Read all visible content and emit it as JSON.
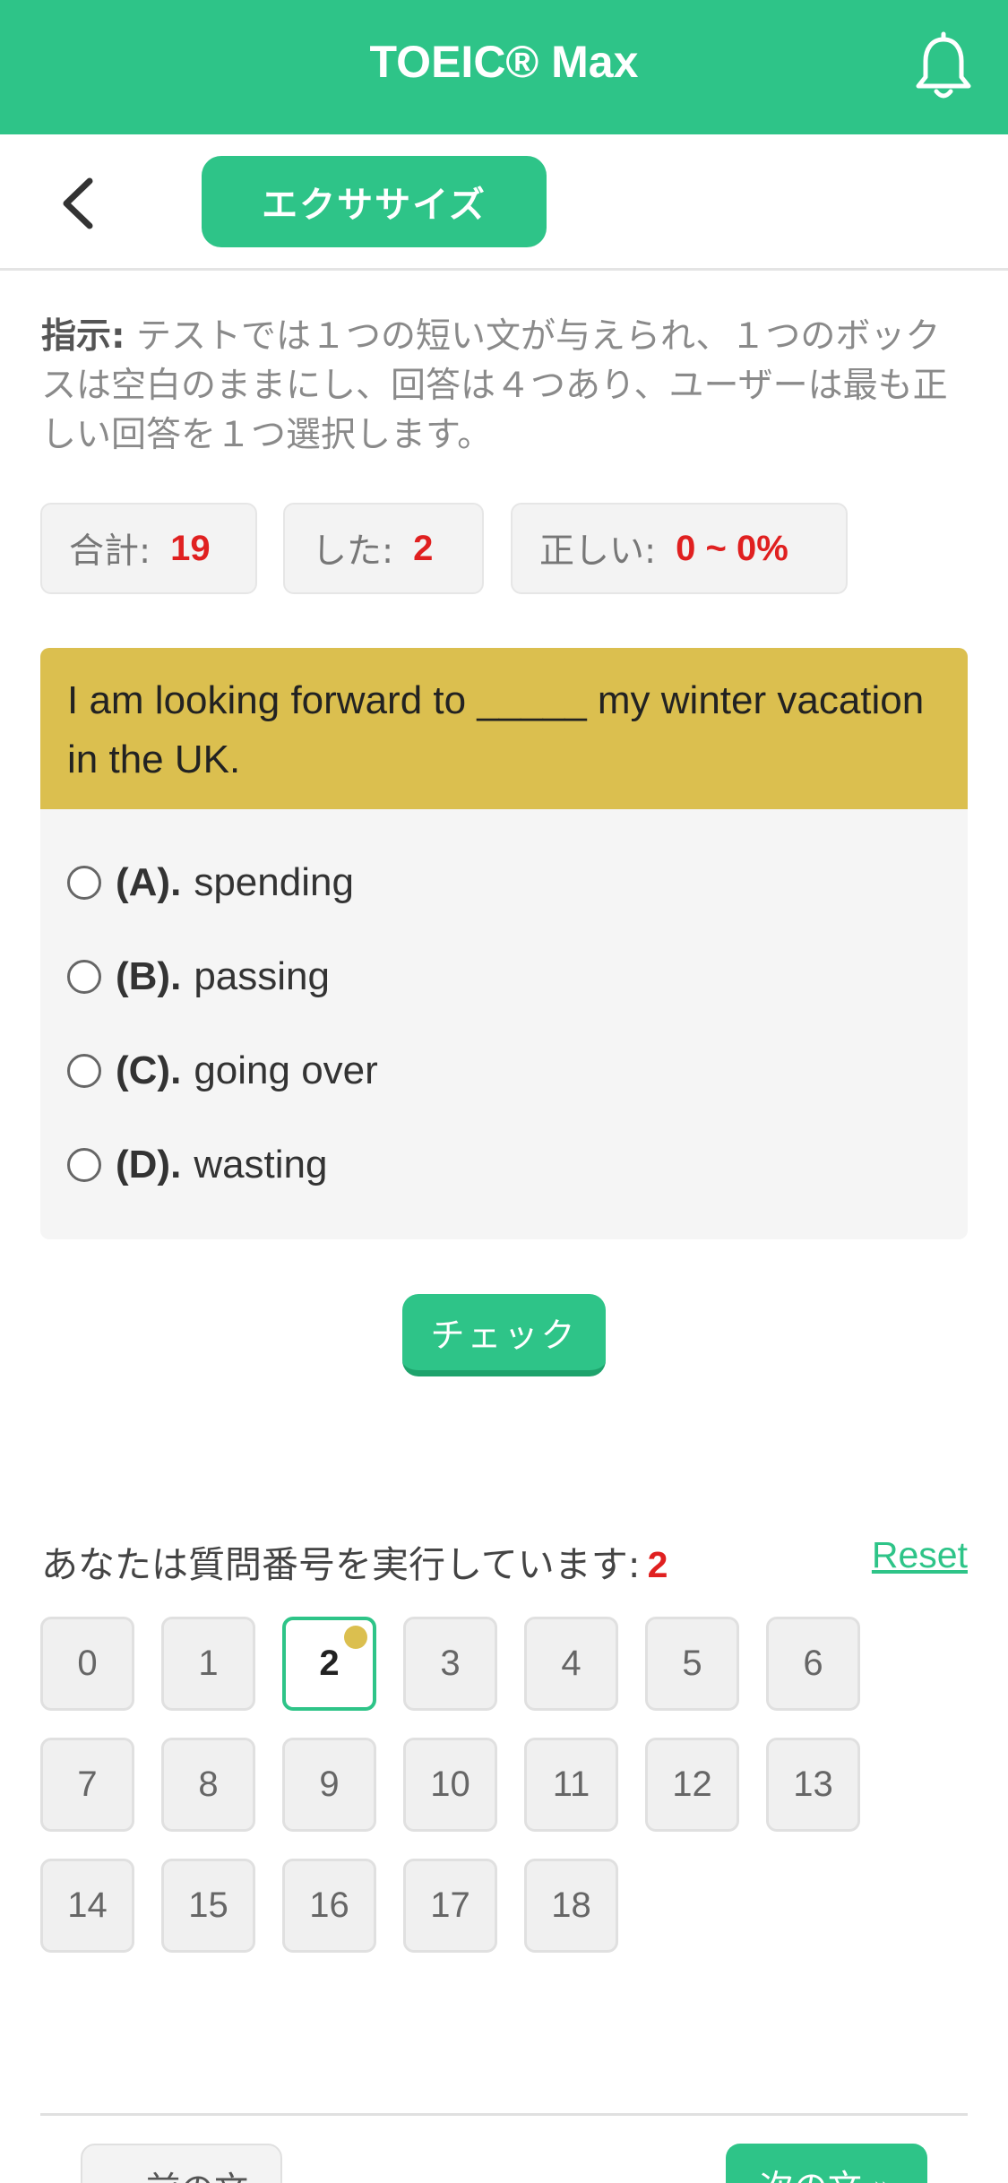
{
  "header": {
    "title": "TOEIC® Max",
    "bell_icon": "bell-icon"
  },
  "subbar": {
    "back_icon": "chevron-left-icon",
    "tab_label": "エクササイズ"
  },
  "instruction": {
    "label": "指示:",
    "text": "テストでは１つの短い文が与えられ、１つのボックスは空白のままにし、回答は４つあり、ユーザーは最も正しい回答を１つ選択します。"
  },
  "stats": {
    "total_label": "合計:",
    "total_value": "19",
    "done_label": "した:",
    "done_value": "2",
    "correct_label": "正しい:",
    "correct_value": "0 ~ 0%"
  },
  "question": {
    "text": "I am looking forward to _____ my winter vacation in the UK.",
    "options": [
      {
        "label": "(A).",
        "text": "spending"
      },
      {
        "label": "(B).",
        "text": "passing"
      },
      {
        "label": "(C).",
        "text": "going over"
      },
      {
        "label": "(D).",
        "text": "wasting"
      }
    ]
  },
  "check_button": "チェック",
  "progress": {
    "label": "あなたは質問番号を実行しています:",
    "current": "2",
    "reset": "Reset"
  },
  "question_numbers": [
    "0",
    "1",
    "2",
    "3",
    "4",
    "5",
    "6",
    "7",
    "8",
    "9",
    "10",
    "11",
    "12",
    "13",
    "14",
    "15",
    "16",
    "17",
    "18"
  ],
  "nav": {
    "prev": "« 前の文",
    "next": "次の文 »"
  },
  "colors": {
    "brand_green": "#2ec488",
    "question_header": "#dbbf4f",
    "highlight_red": "#e02020"
  }
}
